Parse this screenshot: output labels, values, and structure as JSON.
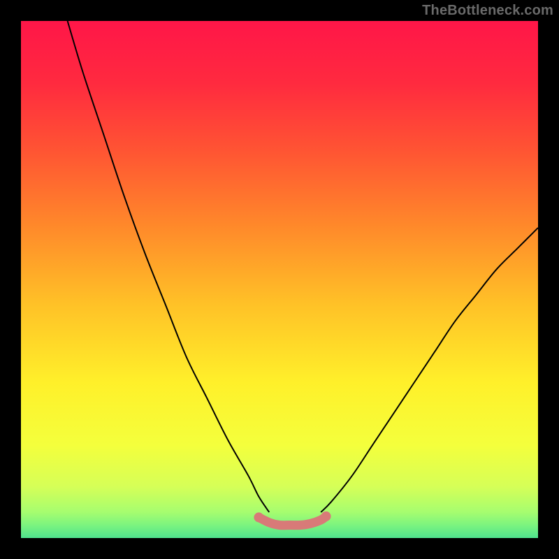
{
  "watermark": "TheBottleneck.com",
  "colors": {
    "frame_bg": "#000000",
    "curve_stroke": "#000000",
    "optimal_marker": "#d87a78",
    "gradient_stops": [
      {
        "offset": 0.0,
        "color": "#ff1648"
      },
      {
        "offset": 0.12,
        "color": "#ff2a3f"
      },
      {
        "offset": 0.25,
        "color": "#ff5433"
      },
      {
        "offset": 0.4,
        "color": "#ff8a2a"
      },
      {
        "offset": 0.55,
        "color": "#ffc227"
      },
      {
        "offset": 0.7,
        "color": "#fff02a"
      },
      {
        "offset": 0.82,
        "color": "#f4ff3c"
      },
      {
        "offset": 0.9,
        "color": "#d6ff57"
      },
      {
        "offset": 0.95,
        "color": "#a6fd6f"
      },
      {
        "offset": 0.975,
        "color": "#7bf47f"
      },
      {
        "offset": 1.0,
        "color": "#4fe38e"
      }
    ]
  },
  "chart_data": {
    "type": "line",
    "title": "",
    "xlabel": "",
    "ylabel": "",
    "xlim": [
      0,
      100
    ],
    "ylim": [
      0,
      100
    ],
    "series": [
      {
        "name": "left-curve",
        "x": [
          9,
          12,
          16,
          20,
          24,
          28,
          32,
          36,
          40,
          44,
          46,
          48
        ],
        "y": [
          100,
          90,
          78,
          66,
          55,
          45,
          35,
          27,
          19,
          12,
          8,
          5
        ]
      },
      {
        "name": "right-curve",
        "x": [
          58,
          60,
          64,
          68,
          72,
          76,
          80,
          84,
          88,
          92,
          96,
          100
        ],
        "y": [
          5,
          7,
          12,
          18,
          24,
          30,
          36,
          42,
          47,
          52,
          56,
          60
        ]
      },
      {
        "name": "optimal-zone-marker",
        "x": [
          46,
          48,
          50,
          52,
          54,
          56,
          58,
          59
        ],
        "y": [
          4,
          3,
          2.5,
          2.5,
          2.5,
          2.8,
          3.5,
          4.2
        ]
      }
    ]
  }
}
